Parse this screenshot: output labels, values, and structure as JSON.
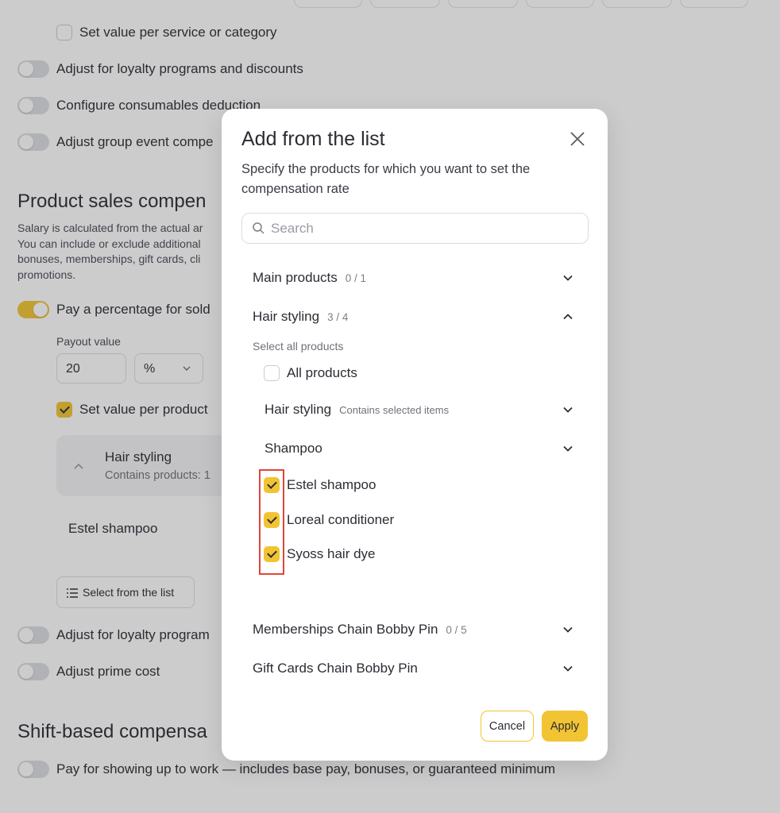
{
  "page": {
    "set_value_service": "Set value per service or category",
    "adjust_loyalty": "Adjust for loyalty programs and discounts",
    "configure_consumables": "Configure consumables deduction",
    "adjust_group": "Adjust group event compe",
    "product_sales_heading": "Product sales compen",
    "product_sales_desc": "Salary is calculated from the actual ar You can include or exclude additional bonuses, memberships, gift cards, cli promotions.",
    "pay_percentage": "Pay a percentage for sold",
    "payout_value_label": "Payout value",
    "payout_value": "20",
    "payout_unit": "%",
    "set_value_product": "Set value per product",
    "card_title": "Hair styling",
    "card_sub": "Contains products: 1",
    "estel_row": "Estel shampoo",
    "select_from_list": "Select from the list",
    "adjust_loyalty2": "Adjust for loyalty program",
    "adjust_prime": "Adjust prime cost",
    "shift_heading": "Shift-based compensa",
    "pay_showing_up": "Pay for showing up to work — includes base pay, bonuses, or guaranteed minimum"
  },
  "modal": {
    "title": "Add from the list",
    "description": "Specify the products for which you want to set the compensation rate",
    "search_placeholder": "Search",
    "sections": [
      {
        "label": "Main products",
        "count": "0 / 1"
      },
      {
        "label": "Hair styling",
        "count": "3 / 4"
      },
      {
        "label": "Memberships Chain Bobby Pin",
        "count": "0 / 5"
      },
      {
        "label": "Gift Cards Chain Bobby Pin",
        "count": ""
      }
    ],
    "select_all_label": "Select all products",
    "all_products": "All products",
    "sub_hair_styling": "Hair styling",
    "sub_hair_styling_note": "Contains selected items",
    "sub_shampoo": "Shampoo",
    "items": [
      {
        "label": "Estel shampoo",
        "checked": true
      },
      {
        "label": "Loreal conditioner",
        "checked": true
      },
      {
        "label": "Syoss hair dye",
        "checked": true
      }
    ],
    "cancel": "Cancel",
    "apply": "Apply"
  },
  "colors": {
    "accent": "#f2c433",
    "highlight": "#e0453a"
  }
}
